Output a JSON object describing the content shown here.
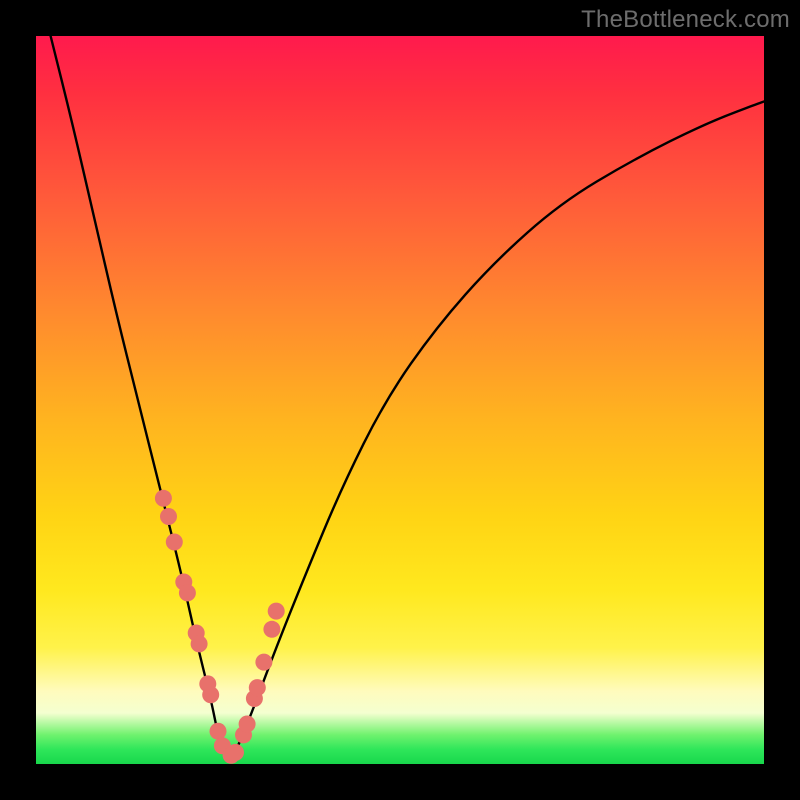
{
  "watermark": "TheBottleneck.com",
  "colors": {
    "frame": "#000000",
    "curve": "#000000",
    "marker_fill": "#e8716b",
    "marker_stroke": "#c84f4b"
  },
  "chart_data": {
    "type": "line",
    "title": "",
    "xlabel": "",
    "ylabel": "",
    "xlim": [
      0,
      100
    ],
    "ylim": [
      0,
      100
    ],
    "grid": false,
    "legend": false,
    "note": "V-shaped bottleneck curve; minimum near x≈26 at y≈0. Axes are unlabeled; values are normalized 0–100 estimates from geometry.",
    "series": [
      {
        "name": "curve",
        "x": [
          2,
          5,
          8,
          11,
          14,
          17,
          20,
          22,
          24,
          25,
          26,
          27,
          28,
          30,
          33,
          37,
          42,
          48,
          55,
          63,
          72,
          82,
          92,
          100
        ],
        "y": [
          100,
          88,
          75,
          62,
          50,
          38,
          26,
          17,
          9,
          4,
          1,
          1,
          3,
          8,
          16,
          26,
          38,
          50,
          60,
          69,
          77,
          83,
          88,
          91
        ]
      }
    ],
    "markers": {
      "name": "highlighted-points",
      "x": [
        17.5,
        18.2,
        19.0,
        20.3,
        20.8,
        22.0,
        22.4,
        23.6,
        24.0,
        25.0,
        25.6,
        26.8,
        27.4,
        28.5,
        29.0,
        30.0,
        30.4,
        31.3,
        32.4,
        33.0
      ],
      "y": [
        36.5,
        34.0,
        30.5,
        25.0,
        23.5,
        18.0,
        16.5,
        11.0,
        9.5,
        4.5,
        2.5,
        1.2,
        1.6,
        4.0,
        5.5,
        9.0,
        10.5,
        14.0,
        18.5,
        21.0
      ]
    }
  }
}
